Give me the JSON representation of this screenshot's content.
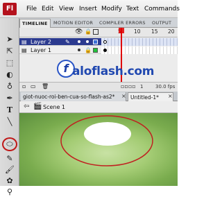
{
  "app": {
    "logo": "Fl"
  },
  "menu": [
    "File",
    "Edit",
    "View",
    "Insert",
    "Modify",
    "Text",
    "Commands"
  ],
  "panel_tabs": {
    "timeline": "TIMELINE",
    "motion_editor": "MOTION EDITOR",
    "compiler_errors": "COMPILER ERRORS",
    "output": "OUTPUT"
  },
  "frame_numbers": [
    "5",
    "10",
    "15",
    "20"
  ],
  "layers": [
    {
      "name": "Layer 2",
      "selected": true,
      "color": "#3b6fd6"
    },
    {
      "name": "Layer 1",
      "selected": false,
      "color": "#22c23a"
    }
  ],
  "timeline_footer": {
    "fps": "30.0 fps"
  },
  "document_tabs": [
    {
      "name": "giot-nuoc-roi-ben-cua-so-flash-as2*",
      "active": false
    },
    {
      "name": "Untitled-1*",
      "active": true
    }
  ],
  "scene": {
    "label": "Scene 1"
  },
  "watermark": {
    "logo_letter": "f",
    "text": "aloflash.com"
  },
  "colors": {
    "accent": "#e00000",
    "selection": "#2b3a8f",
    "stage_green": "#8fbd5c"
  },
  "icons": [
    "arrow-icon",
    "subselect-icon",
    "free-transform-icon",
    "lasso-icon",
    "pen-icon",
    "text-icon",
    "line-icon",
    "oval-icon",
    "pencil-icon",
    "brush-icon",
    "deco-icon",
    "bone-icon",
    "paint-bucket-icon",
    "eyedropper-icon"
  ]
}
